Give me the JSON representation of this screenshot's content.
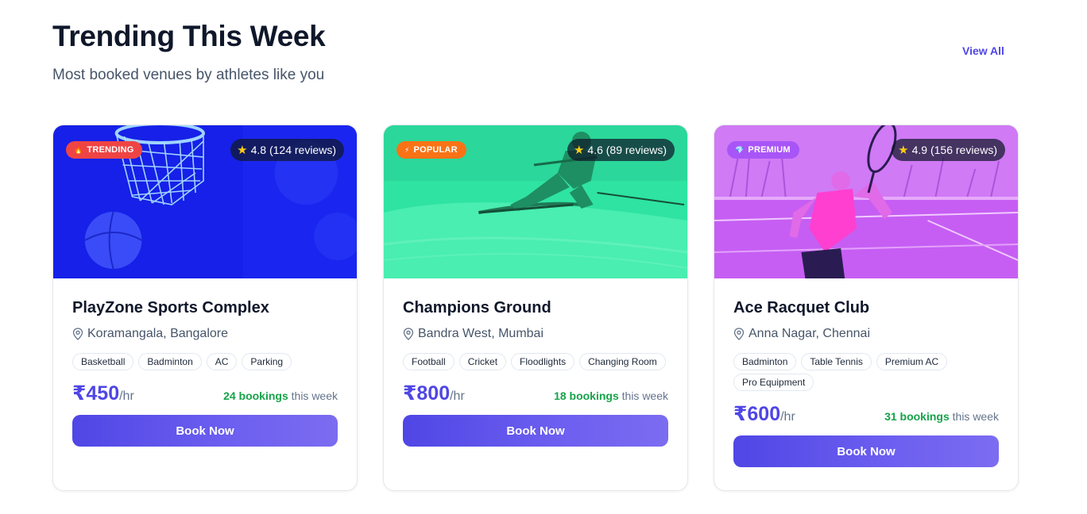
{
  "section": {
    "title": "Trending This Week",
    "subtitle": "Most booked venues by athletes like you",
    "view_all": "View All"
  },
  "venues": [
    {
      "badge": {
        "label": "TRENDING",
        "icon": "fire-icon",
        "glyph": "🔥",
        "color": "#ef4444"
      },
      "rating": "4.8 (124 reviews)",
      "image": "basketball-hoop-photo",
      "overlay_color": "#1d2bf0",
      "name": "PlayZone Sports Complex",
      "location": "Koramangala, Bangalore",
      "tags": [
        "Basketball",
        "Badminton",
        "AC",
        "Parking"
      ],
      "price": "₹450",
      "per": "/hr",
      "bookings_count": "24 bookings",
      "bookings_suffix": "this week",
      "cta": "Book Now"
    },
    {
      "badge": {
        "label": "POPULAR",
        "icon": "lightning-icon",
        "glyph": "⚡",
        "color": "#f97316"
      },
      "rating": "4.6 (89 reviews)",
      "image": "skier-photo",
      "overlay_color": "#2ee6a0",
      "name": "Champions Ground",
      "location": "Bandra West, Mumbai",
      "tags": [
        "Football",
        "Cricket",
        "Floodlights",
        "Changing Room"
      ],
      "price": "₹800",
      "per": "/hr",
      "bookings_count": "18 bookings",
      "bookings_suffix": "this week",
      "cta": "Book Now"
    },
    {
      "badge": {
        "label": "PREMIUM",
        "icon": "diamond-icon",
        "glyph": "💎",
        "color": "#a855f7"
      },
      "rating": "4.9 (156 reviews)",
      "image": "tennis-player-photo",
      "overlay_color": "#c15cf2",
      "name": "Ace Racquet Club",
      "location": "Anna Nagar, Chennai",
      "tags": [
        "Badminton",
        "Table Tennis",
        "Premium AC",
        "Pro Equipment"
      ],
      "price": "₹600",
      "per": "/hr",
      "bookings_count": "31 bookings",
      "bookings_suffix": "this week",
      "cta": "Book Now"
    }
  ]
}
